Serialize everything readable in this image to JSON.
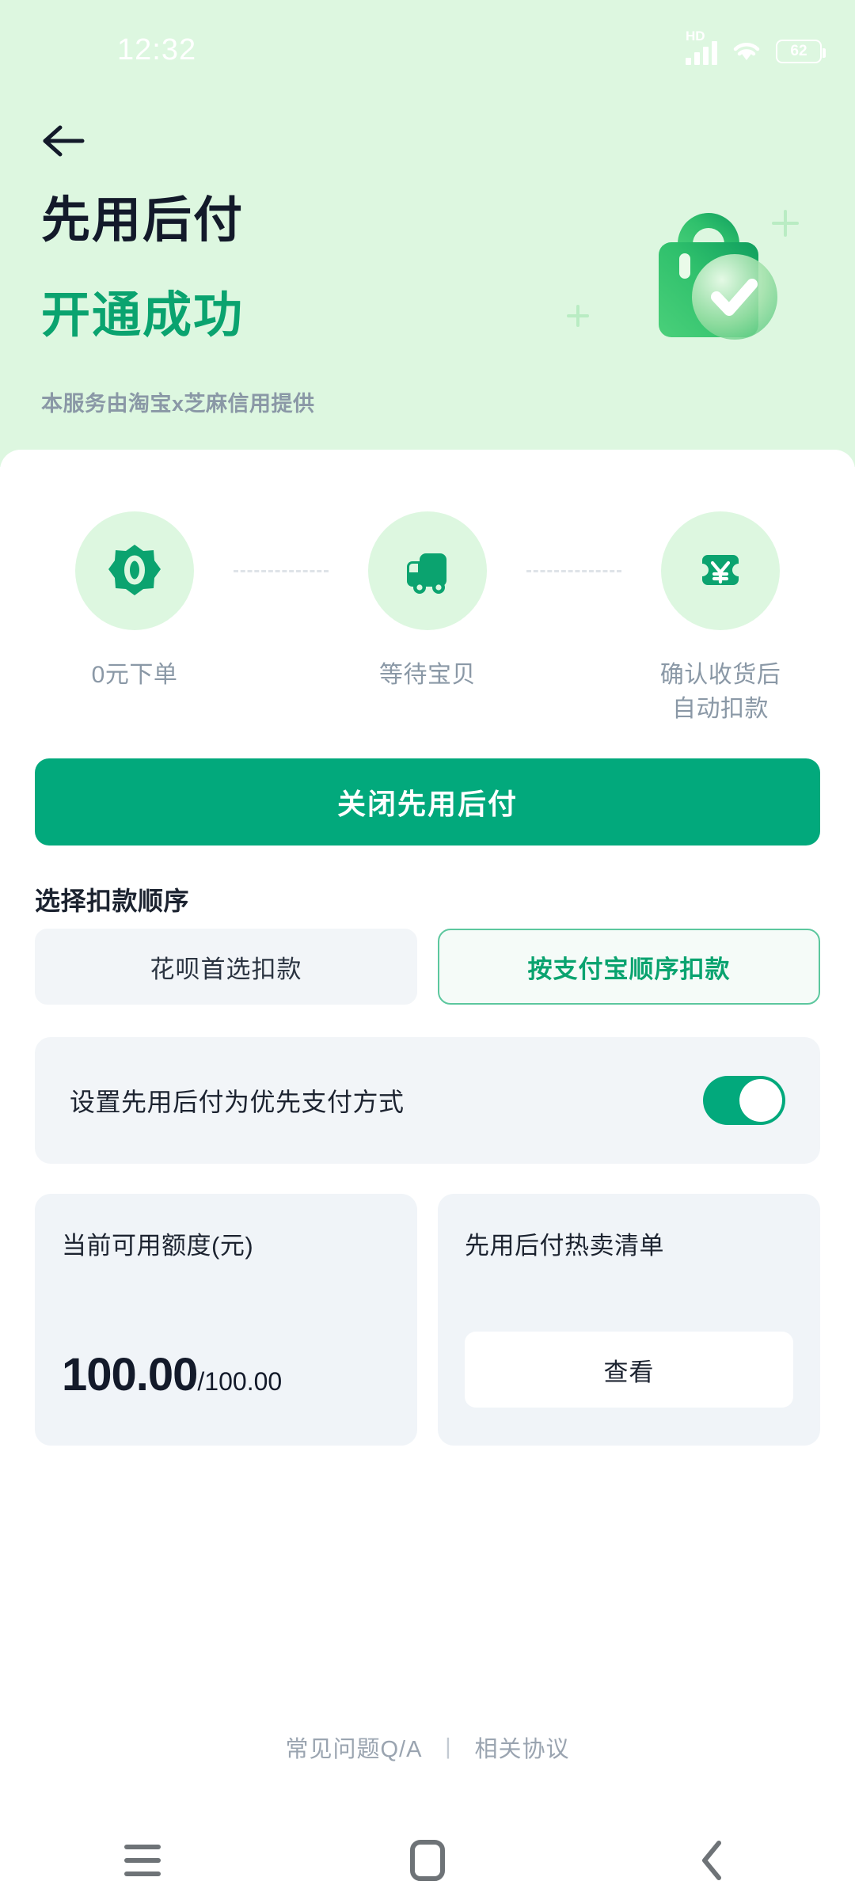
{
  "status_bar": {
    "time": "12:32",
    "network_label": "HD",
    "battery_level": "62",
    "icons": [
      "signal-icon",
      "wifi-icon",
      "battery-icon"
    ]
  },
  "header": {
    "back_icon": "back-arrow-icon",
    "title": "先用后付",
    "subtitle": "开通成功",
    "note": "本服务由淘宝x芝麻信用提供",
    "illustration": "shopping-bag-success-icon"
  },
  "steps": [
    {
      "icon": "zero-badge-icon",
      "label": "0元下单"
    },
    {
      "icon": "delivery-truck-icon",
      "label": "等待宝贝"
    },
    {
      "icon": "yen-coupon-icon",
      "label": "确认收货后\n自动扣款"
    }
  ],
  "primary_button": {
    "label": "关闭先用后付"
  },
  "deduction_order": {
    "title": "选择扣款顺序",
    "options": [
      {
        "label": "花呗首选扣款",
        "selected": false
      },
      {
        "label": "按支付宝顺序扣款",
        "selected": true
      }
    ]
  },
  "priority_toggle": {
    "label": "设置先用后付为优先支付方式",
    "state": "on"
  },
  "quota_card": {
    "title": "当前可用额度(元)",
    "available": "100.00",
    "total": "/100.00"
  },
  "hot_list_card": {
    "title": "先用后付热卖清单",
    "button_label": "查看"
  },
  "footer": {
    "faq_link": "常见问题Q/A",
    "separator": "丨",
    "agreement_link": "相关协议"
  },
  "nav_bar": {
    "recents": "menu-icon",
    "home": "home-square-icon",
    "back": "back-chevron-icon"
  },
  "colors": {
    "hero_bg": "#ddf7e0",
    "brand_green": "#02a97c",
    "accent_green": "#0aa36f",
    "title_dark": "#131a2a",
    "muted_gray": "#8a98a6",
    "card_bg": "#f0f4f8"
  }
}
